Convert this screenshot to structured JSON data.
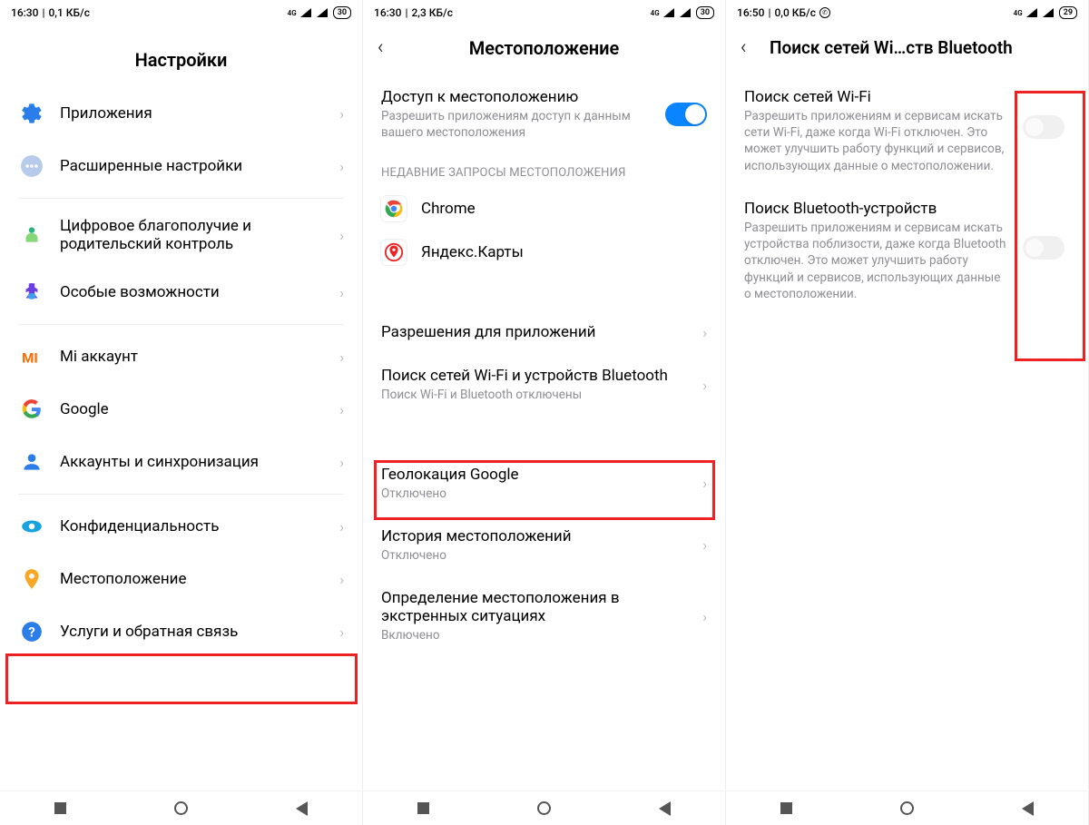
{
  "screen1": {
    "status": {
      "time": "16:30",
      "speed": "0,1 КБ/с",
      "net": "4G",
      "battery": "30"
    },
    "title": "Настройки",
    "items": [
      {
        "label": "Приложения"
      },
      {
        "label": "Расширенные настройки"
      }
    ],
    "items2": [
      {
        "label": "Цифровое благополучие и родительский контроль"
      },
      {
        "label": "Особые возможности"
      }
    ],
    "items3": [
      {
        "label": "Mi аккаунт"
      },
      {
        "label": "Google"
      },
      {
        "label": "Аккаунты и синхронизация"
      }
    ],
    "items4": [
      {
        "label": "Конфиденциальность"
      },
      {
        "label": "Местоположение"
      },
      {
        "label": "Услуги и обратная связь"
      }
    ]
  },
  "screen2": {
    "status": {
      "time": "16:30",
      "speed": "2,3 КБ/с",
      "net": "4G",
      "battery": "30"
    },
    "title": "Местоположение",
    "access": {
      "label": "Доступ к местоположению",
      "sub": "Разрешить приложениям доступ к данным вашего местоположения"
    },
    "recent_header": "НЕДАВНИЕ ЗАПРОСЫ МЕСТОПОЛОЖЕНИЯ",
    "recent": [
      {
        "label": "Chrome"
      },
      {
        "label": "Яндекс.Карты"
      }
    ],
    "perm": {
      "label": "Разрешения для приложений"
    },
    "scan": {
      "label": "Поиск сетей Wi-Fi и устройств Bluetooth",
      "sub": "Поиск Wi-Fi и Bluetooth отключены"
    },
    "geo": {
      "label": "Геолокация Google",
      "sub": "Отключено"
    },
    "hist": {
      "label": "История местоположений",
      "sub": "Отключено"
    },
    "emerg": {
      "label": "Определение местоположения в экстренных ситуациях",
      "sub": "Включено"
    }
  },
  "screen3": {
    "status": {
      "time": "16:50",
      "speed": "0,0 КБ/с",
      "net": "4G",
      "battery": "29"
    },
    "title": "Поиск сетей Wi…ств Bluetooth",
    "wifi": {
      "label": "Поиск сетей Wi-Fi",
      "sub": "Разрешить приложениям и сервисам искать сети Wi-Fi, даже когда Wi-Fi отключен. Это может улучшить работу функций и сервисов, использующих данные о местоположении."
    },
    "bt": {
      "label": "Поиск Bluetooth-устройств",
      "sub": "Разрешить приложениям и сервисам искать устройства поблизости, даже когда Bluetooth отключен. Это может улучшить работу функций и сервисов, использующих данные о местоположении."
    }
  }
}
